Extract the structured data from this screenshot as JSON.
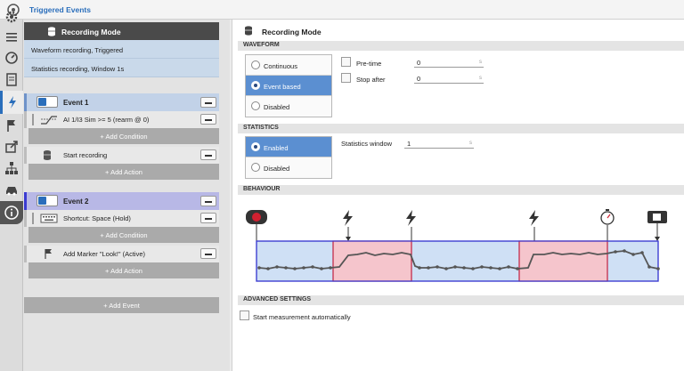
{
  "window": {
    "title": "Triggered Events"
  },
  "sidebar_icons": [
    "gear-icon",
    "list-icon",
    "gauge-icon",
    "clipboard-icon",
    "lightning-icon",
    "flag-icon",
    "export-icon",
    "network-icon",
    "car-icon",
    "info-icon"
  ],
  "recording_mode_card": {
    "header": "Recording Mode",
    "rows": [
      "Waveform recording, Triggered",
      "Statistics recording, Window 1s"
    ]
  },
  "events": [
    {
      "label": "Event 1",
      "conditions": [
        {
          "text": "AI 1/I3 Sim >= 5 (rearm @ 0)",
          "icon": "threshold-icon"
        }
      ],
      "add_condition": "+ Add Condition",
      "actions": [
        {
          "text": "Start recording",
          "icon": "database-icon"
        }
      ],
      "add_action": "+ Add Action",
      "stripe_color": "#6e92c9"
    },
    {
      "label": "Event 2",
      "conditions": [
        {
          "text": "Shortcut: Space (Hold)",
          "icon": "keyboard-icon"
        }
      ],
      "add_condition": "+ Add Condition",
      "actions": [
        {
          "text": "Add Marker \"Look!\" (Active)",
          "icon": "flag-icon"
        }
      ],
      "add_action": "+ Add Action",
      "stripe_color": "#3b3bd1"
    }
  ],
  "add_event": "+ Add Event",
  "right_panel": {
    "title": "Recording Mode",
    "waveform": {
      "header": "WAVEFORM",
      "options": [
        "Continuous",
        "Event based",
        "Disabled"
      ],
      "selected": "Event based",
      "pre_time_label": "Pre-time",
      "pre_time_value": "0",
      "stop_after_label": "Stop after",
      "stop_after_value": "0",
      "unit": "s"
    },
    "statistics": {
      "header": "STATISTICS",
      "options": [
        "Enabled",
        "Disabled"
      ],
      "selected": "Enabled",
      "window_label": "Statistics window",
      "window_value": "1",
      "unit": "s"
    },
    "behaviour": {
      "header": "BEHAVIOUR"
    },
    "advanced": {
      "header": "ADVANCED SETTINGS",
      "start_auto_label": "Start measurement automatically"
    }
  },
  "colors": {
    "accent": "#2a6ebb",
    "selected": "#5b8fd1",
    "event1": "#c2d2e8",
    "event2": "#b8b8e6",
    "recording_region": "#f5c5cc",
    "idle_region": "#cfe0f5"
  }
}
